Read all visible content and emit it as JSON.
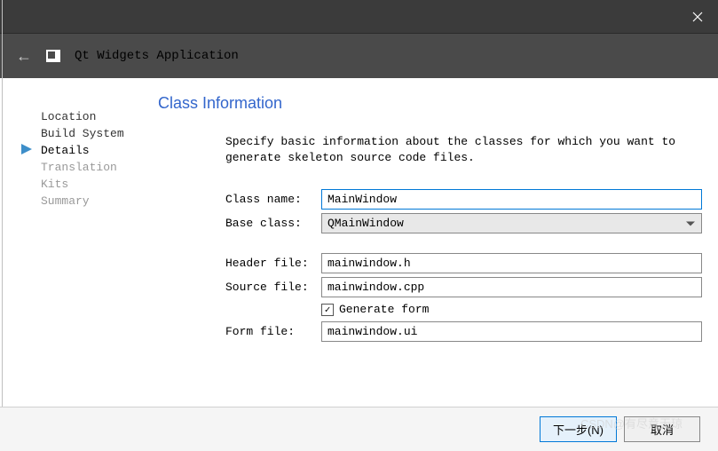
{
  "header": {
    "title": "Qt Widgets Application"
  },
  "sidebar": {
    "items": [
      {
        "label": "Location",
        "state": "done"
      },
      {
        "label": "Build System",
        "state": "done"
      },
      {
        "label": "Details",
        "state": "active"
      },
      {
        "label": "Translation",
        "state": "disabled"
      },
      {
        "label": "Kits",
        "state": "disabled"
      },
      {
        "label": "Summary",
        "state": "disabled"
      }
    ]
  },
  "page": {
    "title": "Class Information",
    "description": "Specify basic information about the classes for which you want to generate skeleton source code files."
  },
  "form": {
    "className": {
      "label": "Class name:",
      "value": "MainWindow"
    },
    "baseClass": {
      "label": "Base class:",
      "value": "QMainWindow"
    },
    "headerFile": {
      "label": "Header file:",
      "value": "mainwindow.h"
    },
    "sourceFile": {
      "label": "Source file:",
      "value": "mainwindow.cpp"
    },
    "generateForm": {
      "label": "Generate form",
      "checked": true
    },
    "formFile": {
      "label": "Form file:",
      "value": "mainwindow.ui"
    }
  },
  "footer": {
    "next": "下一步(N)",
    "cancel": "取消"
  },
  "watermark": "CSDN@有尽意无琼"
}
